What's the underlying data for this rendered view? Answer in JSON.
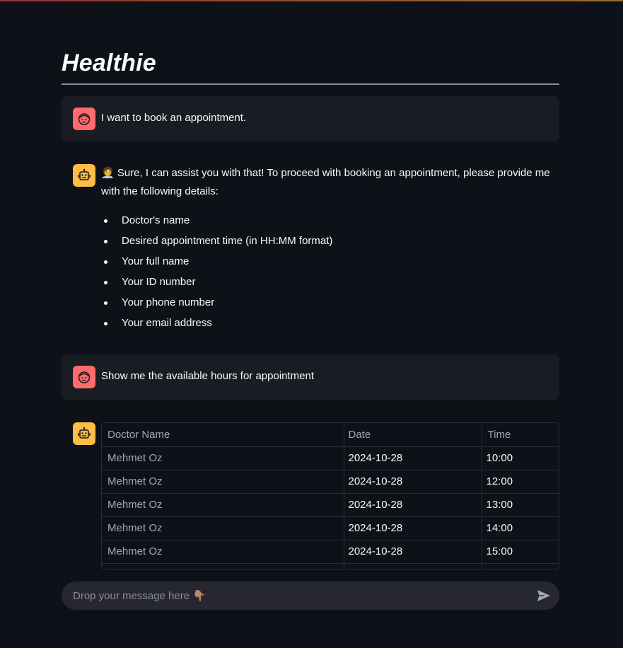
{
  "app": {
    "title": "Healthie"
  },
  "messages": [
    {
      "role": "user",
      "avatar_icon": "user-face-icon",
      "text": "I want to book an appointment."
    },
    {
      "role": "assistant",
      "avatar_icon": "robot-icon",
      "intro_line1": "🧑‍⚕️ Sure, I can assist you with that! To proceed with booking an appointment, please provide me",
      "intro_line2": "with the following details:",
      "bullets": [
        "Doctor's name",
        "Desired appointment time (in HH:MM format)",
        "Your full name",
        "Your ID number",
        "Your phone number",
        "Your email address"
      ]
    },
    {
      "role": "user",
      "avatar_icon": "user-face-icon",
      "text": "Show me the available hours for appointment"
    },
    {
      "role": "assistant",
      "avatar_icon": "robot-icon",
      "table": {
        "columns": [
          "Doctor Name",
          "Date",
          "Time"
        ],
        "rows": [
          [
            "Mehmet Oz",
            "2024-10-28",
            "10:00"
          ],
          [
            "Mehmet Oz",
            "2024-10-28",
            "12:00"
          ],
          [
            "Mehmet Oz",
            "2024-10-28",
            "13:00"
          ],
          [
            "Mehmet Oz",
            "2024-10-28",
            "14:00"
          ],
          [
            "Mehmet Oz",
            "2024-10-28",
            "15:00"
          ],
          [
            "",
            "",
            ""
          ]
        ]
      }
    }
  ],
  "chat_input": {
    "placeholder": "Drop your message here 👇🏽",
    "send_icon": "send-icon"
  },
  "colors": {
    "background": "#0e1117",
    "user_bubble": "#1a1c24",
    "user_avatar": "#ff6b6b",
    "bot_avatar": "#ffbd45",
    "input_bg": "#262730"
  }
}
